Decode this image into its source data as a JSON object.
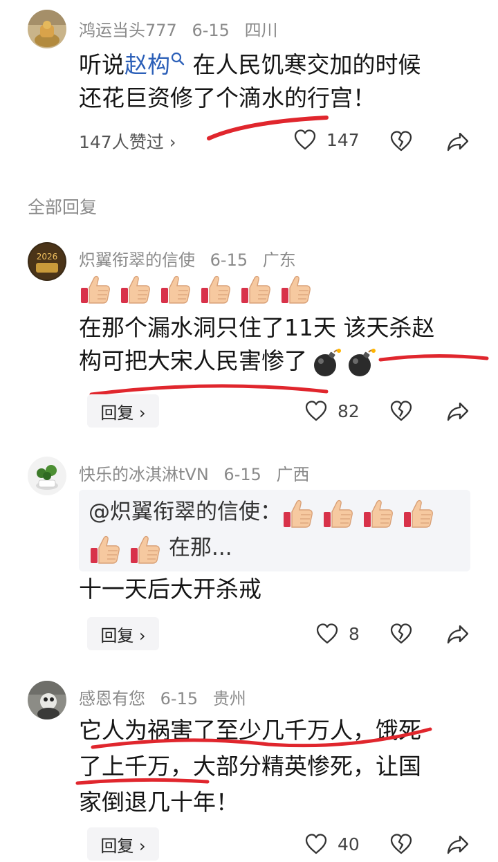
{
  "main_post": {
    "user": "鸿运当头777",
    "date": "6-15",
    "location": "四川",
    "text_prefix": "听说",
    "text_link": "赵构",
    "text_line1_rest": "在人民饥寒交加的时候",
    "text_line2": "还花巨资修了个滴水的行宫！",
    "likers": "147人赞过 ›",
    "like_count": "147"
  },
  "section_title": "全部回复",
  "replies": [
    {
      "user": "炽翼衔翠的信使",
      "date": "6-15",
      "location": "广东",
      "line1": "在那个漏水洞只住了11天 该天杀赵",
      "line2": "构可把大宋人民害惨了",
      "reply_label": "回复 ›",
      "like_count": "82"
    },
    {
      "user": "快乐的冰淇淋tVN",
      "date": "6-15",
      "location": "广西",
      "quote_prefix": "@炽翼衔翠的信使：",
      "quote_suffix": "在那...",
      "text": "十一天后大开杀戒",
      "reply_label": "回复 ›",
      "like_count": "8"
    },
    {
      "user": "感恩有您",
      "date": "6-15",
      "location": "贵州",
      "line1": "它人为祸害了至少几千万人，饿死",
      "line2": "了上千万，大部分精英惨死，让国",
      "line3": "家倒退几十年！",
      "reply_label": "回复 ›",
      "like_count": "40"
    }
  ],
  "colors": {
    "underline": "#e0262d",
    "link": "#2b5fb8",
    "meta": "#8a8a8a"
  },
  "icons": [
    "heart-icon",
    "broken-heart-icon",
    "share-icon",
    "thumbs-up-emoji",
    "bomb-emoji",
    "search-icon"
  ]
}
